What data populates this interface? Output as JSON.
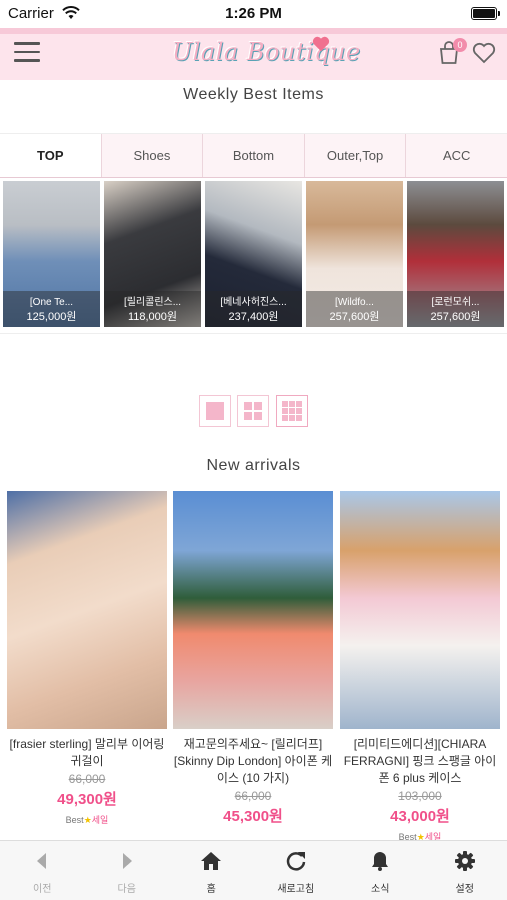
{
  "status_bar": {
    "carrier": "Carrier",
    "time": "1:26 PM"
  },
  "header": {
    "logo_text": "Ulala Boutique",
    "cart_count": "0"
  },
  "weekly": {
    "title": "Weekly Best Items",
    "tabs": [
      "TOP",
      "Shoes",
      "Bottom",
      "Outer,Top",
      "ACC"
    ],
    "items": [
      {
        "name": "[One Te...",
        "price": "125,000원"
      },
      {
        "name": "[릴리콜린스...",
        "price": "118,000원"
      },
      {
        "name": "[베네사허진스...",
        "price": "237,400원"
      },
      {
        "name": "[Wildfo...",
        "price": "257,600원"
      },
      {
        "name": "[로런모쉬...",
        "price": "257,600원"
      }
    ]
  },
  "new_arrivals": {
    "title": "New arrivals",
    "products": [
      {
        "name": "[frasier sterling] 말리부 이어링 귀걸이",
        "old_price": "66,000",
        "price": "49,300원",
        "badge": "Best",
        "badge2": "세일"
      },
      {
        "name": "재고문의주세요~ [릴리더프][Skinny Dip London] 아이폰 케이스 (10 가지)",
        "old_price": "66,000",
        "price": "45,300원"
      },
      {
        "name": "[리미티드에디션][CHIARA FERRAGNI] 핑크 스팽글 아이폰 6 plus 케이스",
        "old_price": "103,000",
        "price": "43,000원",
        "badge": "Best",
        "badge2": "세일"
      }
    ]
  },
  "bottom_nav": {
    "items": [
      {
        "label": "이전",
        "icon": "back-icon"
      },
      {
        "label": "다음",
        "icon": "forward-icon"
      },
      {
        "label": "홈",
        "icon": "home-icon"
      },
      {
        "label": "새로고침",
        "icon": "refresh-icon"
      },
      {
        "label": "소식",
        "icon": "bell-icon"
      },
      {
        "label": "설정",
        "icon": "gear-icon"
      }
    ]
  },
  "colors": {
    "accent": "#f0508a",
    "header_bg": "#fde4ec",
    "tab_bg": "#fdf3f6"
  }
}
